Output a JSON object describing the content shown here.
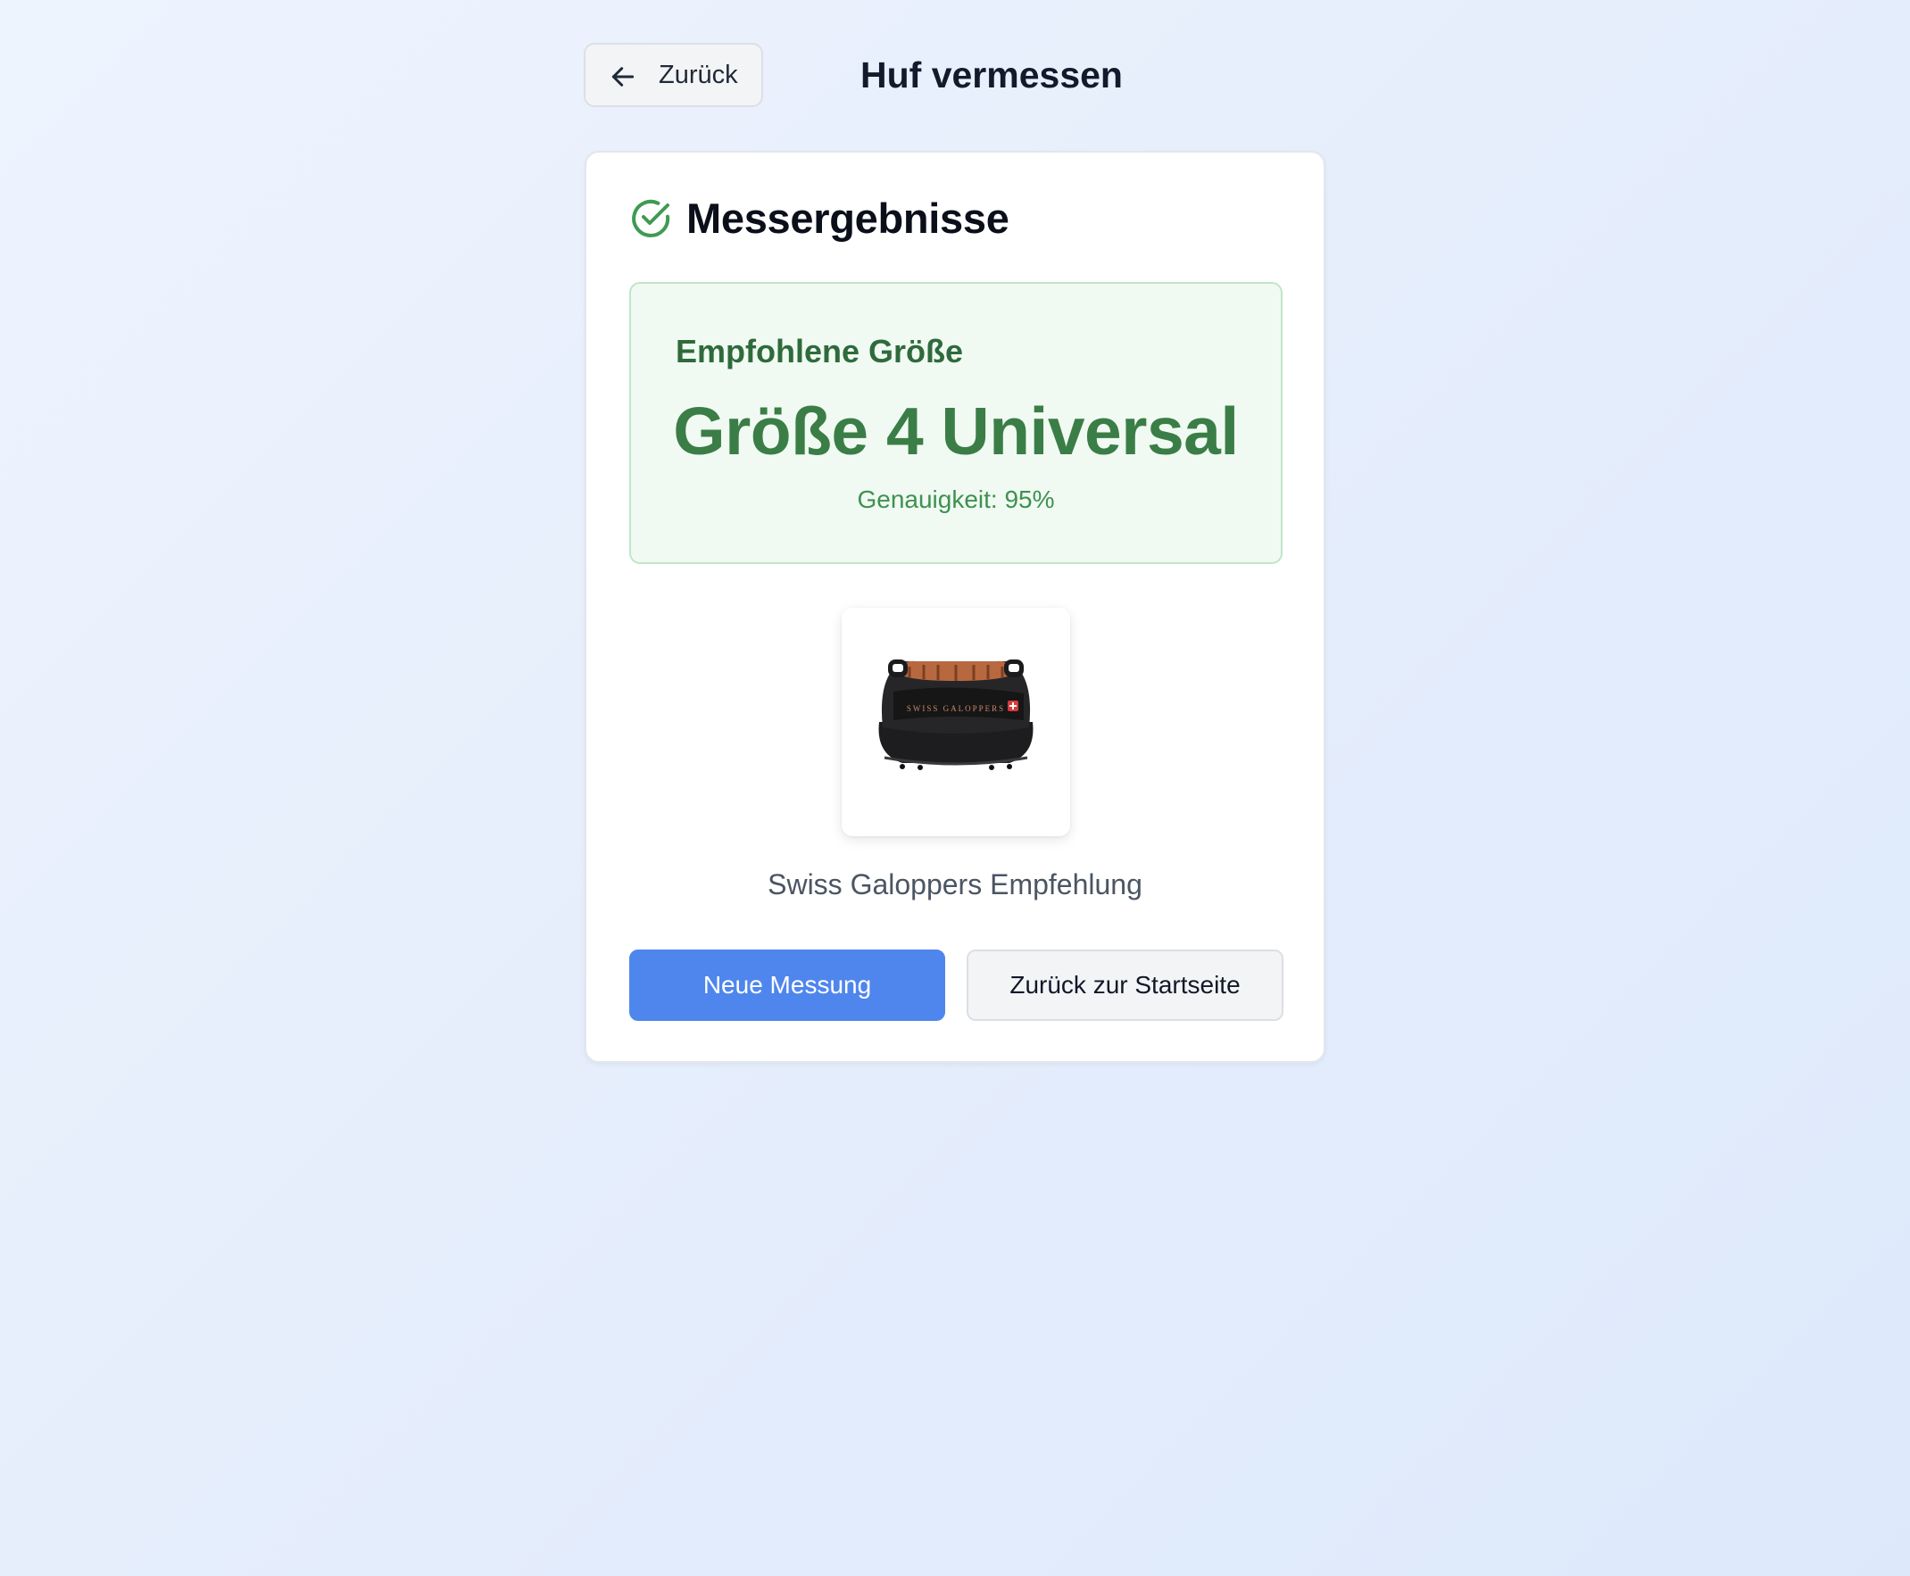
{
  "header": {
    "back_label": "Zurück",
    "back_icon": "arrow-left-icon",
    "title": "Huf vermessen"
  },
  "card": {
    "title": "Messergebnisse",
    "title_icon": "check-circle-icon",
    "result": {
      "label": "Empfohlene Größe",
      "value": "Größe 4 Universal",
      "accuracy": "Genauigkeit: 95%"
    },
    "product": {
      "image_icon": "hoof-boot-image",
      "brand_text": "SWISS GALOPPERS",
      "caption": "Swiss Galoppers Empfehlung"
    },
    "actions": {
      "primary_label": "Neue Messung",
      "secondary_label": "Zurück zur Startseite"
    }
  },
  "colors": {
    "accent_blue": "#4f86ed",
    "success_green": "#3b7d47",
    "success_bg": "#f0faf2",
    "success_border": "#bfe6c8"
  }
}
